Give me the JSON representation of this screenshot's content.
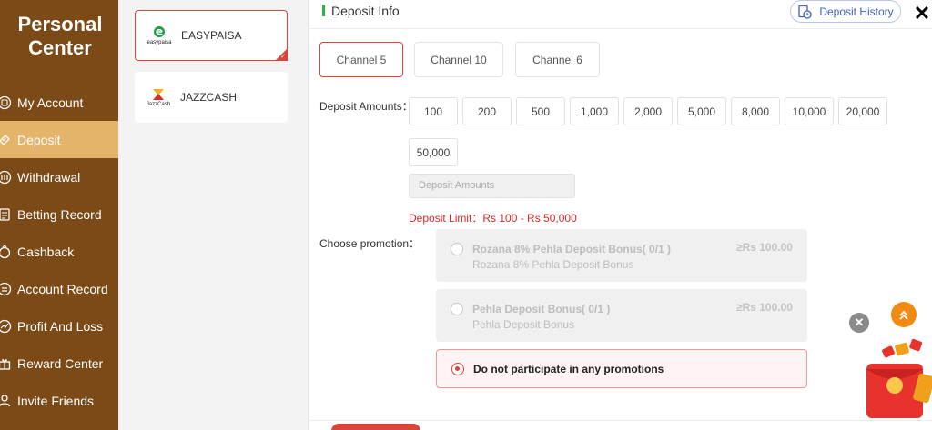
{
  "sidebar": {
    "title": "Personal Center",
    "items": [
      {
        "label": "My Account",
        "icon": "account-icon"
      },
      {
        "label": "Deposit",
        "icon": "deposit-icon",
        "active": true
      },
      {
        "label": "Withdrawal",
        "icon": "withdrawal-icon"
      },
      {
        "label": "Betting Record",
        "icon": "betting-record-icon"
      },
      {
        "label": "Cashback",
        "icon": "cashback-icon"
      },
      {
        "label": "Account Record",
        "icon": "account-record-icon"
      },
      {
        "label": "Profit And Loss",
        "icon": "profit-loss-icon"
      },
      {
        "label": "Reward Center",
        "icon": "reward-icon"
      },
      {
        "label": "Invite Friends",
        "icon": "invite-icon"
      }
    ]
  },
  "payment_methods": [
    {
      "label": "EASYPAISA",
      "logo_text": "easypaisa",
      "selected": true
    },
    {
      "label": "JAZZCASH",
      "logo_text": "JazzCash",
      "selected": false
    }
  ],
  "header": {
    "title": "Deposit Info",
    "history_label": "Deposit History"
  },
  "channels": [
    {
      "label": "Channel 5",
      "selected": true
    },
    {
      "label": "Channel 10",
      "selected": false
    },
    {
      "label": "Channel 6",
      "selected": false
    }
  ],
  "deposit": {
    "amounts_label": "Deposit Amounts：",
    "amounts": [
      "100",
      "200",
      "500",
      "1,000",
      "2,000",
      "5,000",
      "8,000",
      "10,000",
      "20,000",
      "50,000"
    ],
    "input_placeholder": "Deposit Amounts",
    "limit_text": "Deposit Limit：Rs  100  - Rs  50,000"
  },
  "promotion": {
    "label": "Choose promotion：",
    "options": [
      {
        "title": "Rozana 8% Pehla Deposit Bonus( 0/1 )",
        "subtitle": "Rozana 8% Pehla Deposit Bonus",
        "amount": "≥Rs  100.00",
        "disabled": true
      },
      {
        "title": "Pehla Deposit Bonus( 0/1 )",
        "subtitle": "Pehla Deposit Bonus",
        "amount": "≥Rs  100.00",
        "disabled": true
      },
      {
        "title": "Do not participate in any promotions",
        "selected": true
      }
    ]
  },
  "colors": {
    "sidebar_bg": "#7b4a16",
    "sidebar_active": "#e3b46a",
    "accent_red": "#d9443b",
    "limit_red": "#d42a2a",
    "history_blue": "#4161b6",
    "header_bar_green": "#2bb34a"
  }
}
